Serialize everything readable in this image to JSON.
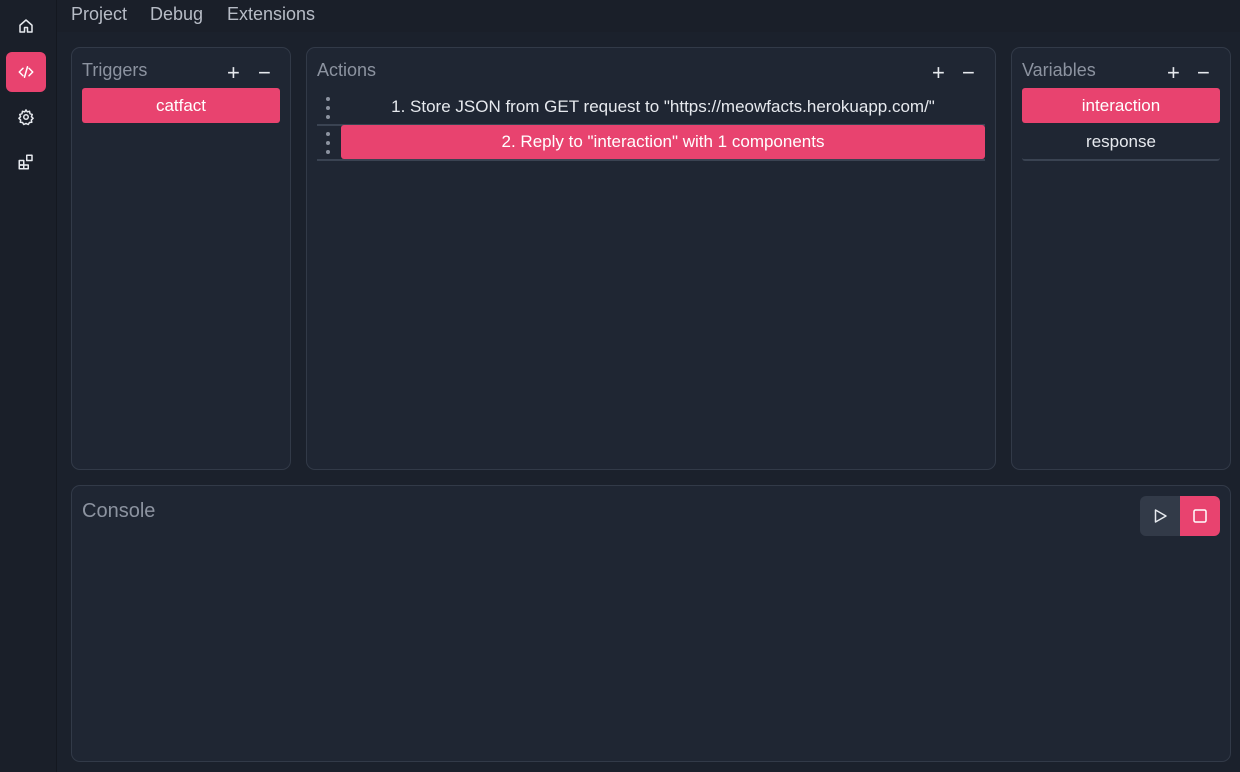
{
  "sidebar": {
    "items": [
      {
        "icon": "home-icon",
        "active": false
      },
      {
        "icon": "code-icon",
        "active": true
      },
      {
        "icon": "gear-icon",
        "active": false
      },
      {
        "icon": "extensions-icon",
        "active": false
      }
    ]
  },
  "menu": {
    "items": [
      "Project",
      "Debug",
      "Extensions"
    ]
  },
  "triggers": {
    "title": "Triggers",
    "add": "+",
    "remove": "−",
    "items": [
      "catfact"
    ]
  },
  "actions": {
    "title": "Actions",
    "add": "+",
    "remove": "−",
    "items": [
      "1. Store JSON from GET request to \"https://meowfacts.herokuapp.com/\"",
      "2. Reply to \"interaction\" with 1 components"
    ]
  },
  "variables": {
    "title": "Variables",
    "add": "+",
    "remove": "−",
    "items": [
      "interaction",
      "response"
    ]
  },
  "console": {
    "title": "Console",
    "controls": [
      "play-icon",
      "stop-icon"
    ]
  },
  "colors": {
    "accent": "#e8436f",
    "background": "#1b212c",
    "panel": "#1f2633"
  }
}
